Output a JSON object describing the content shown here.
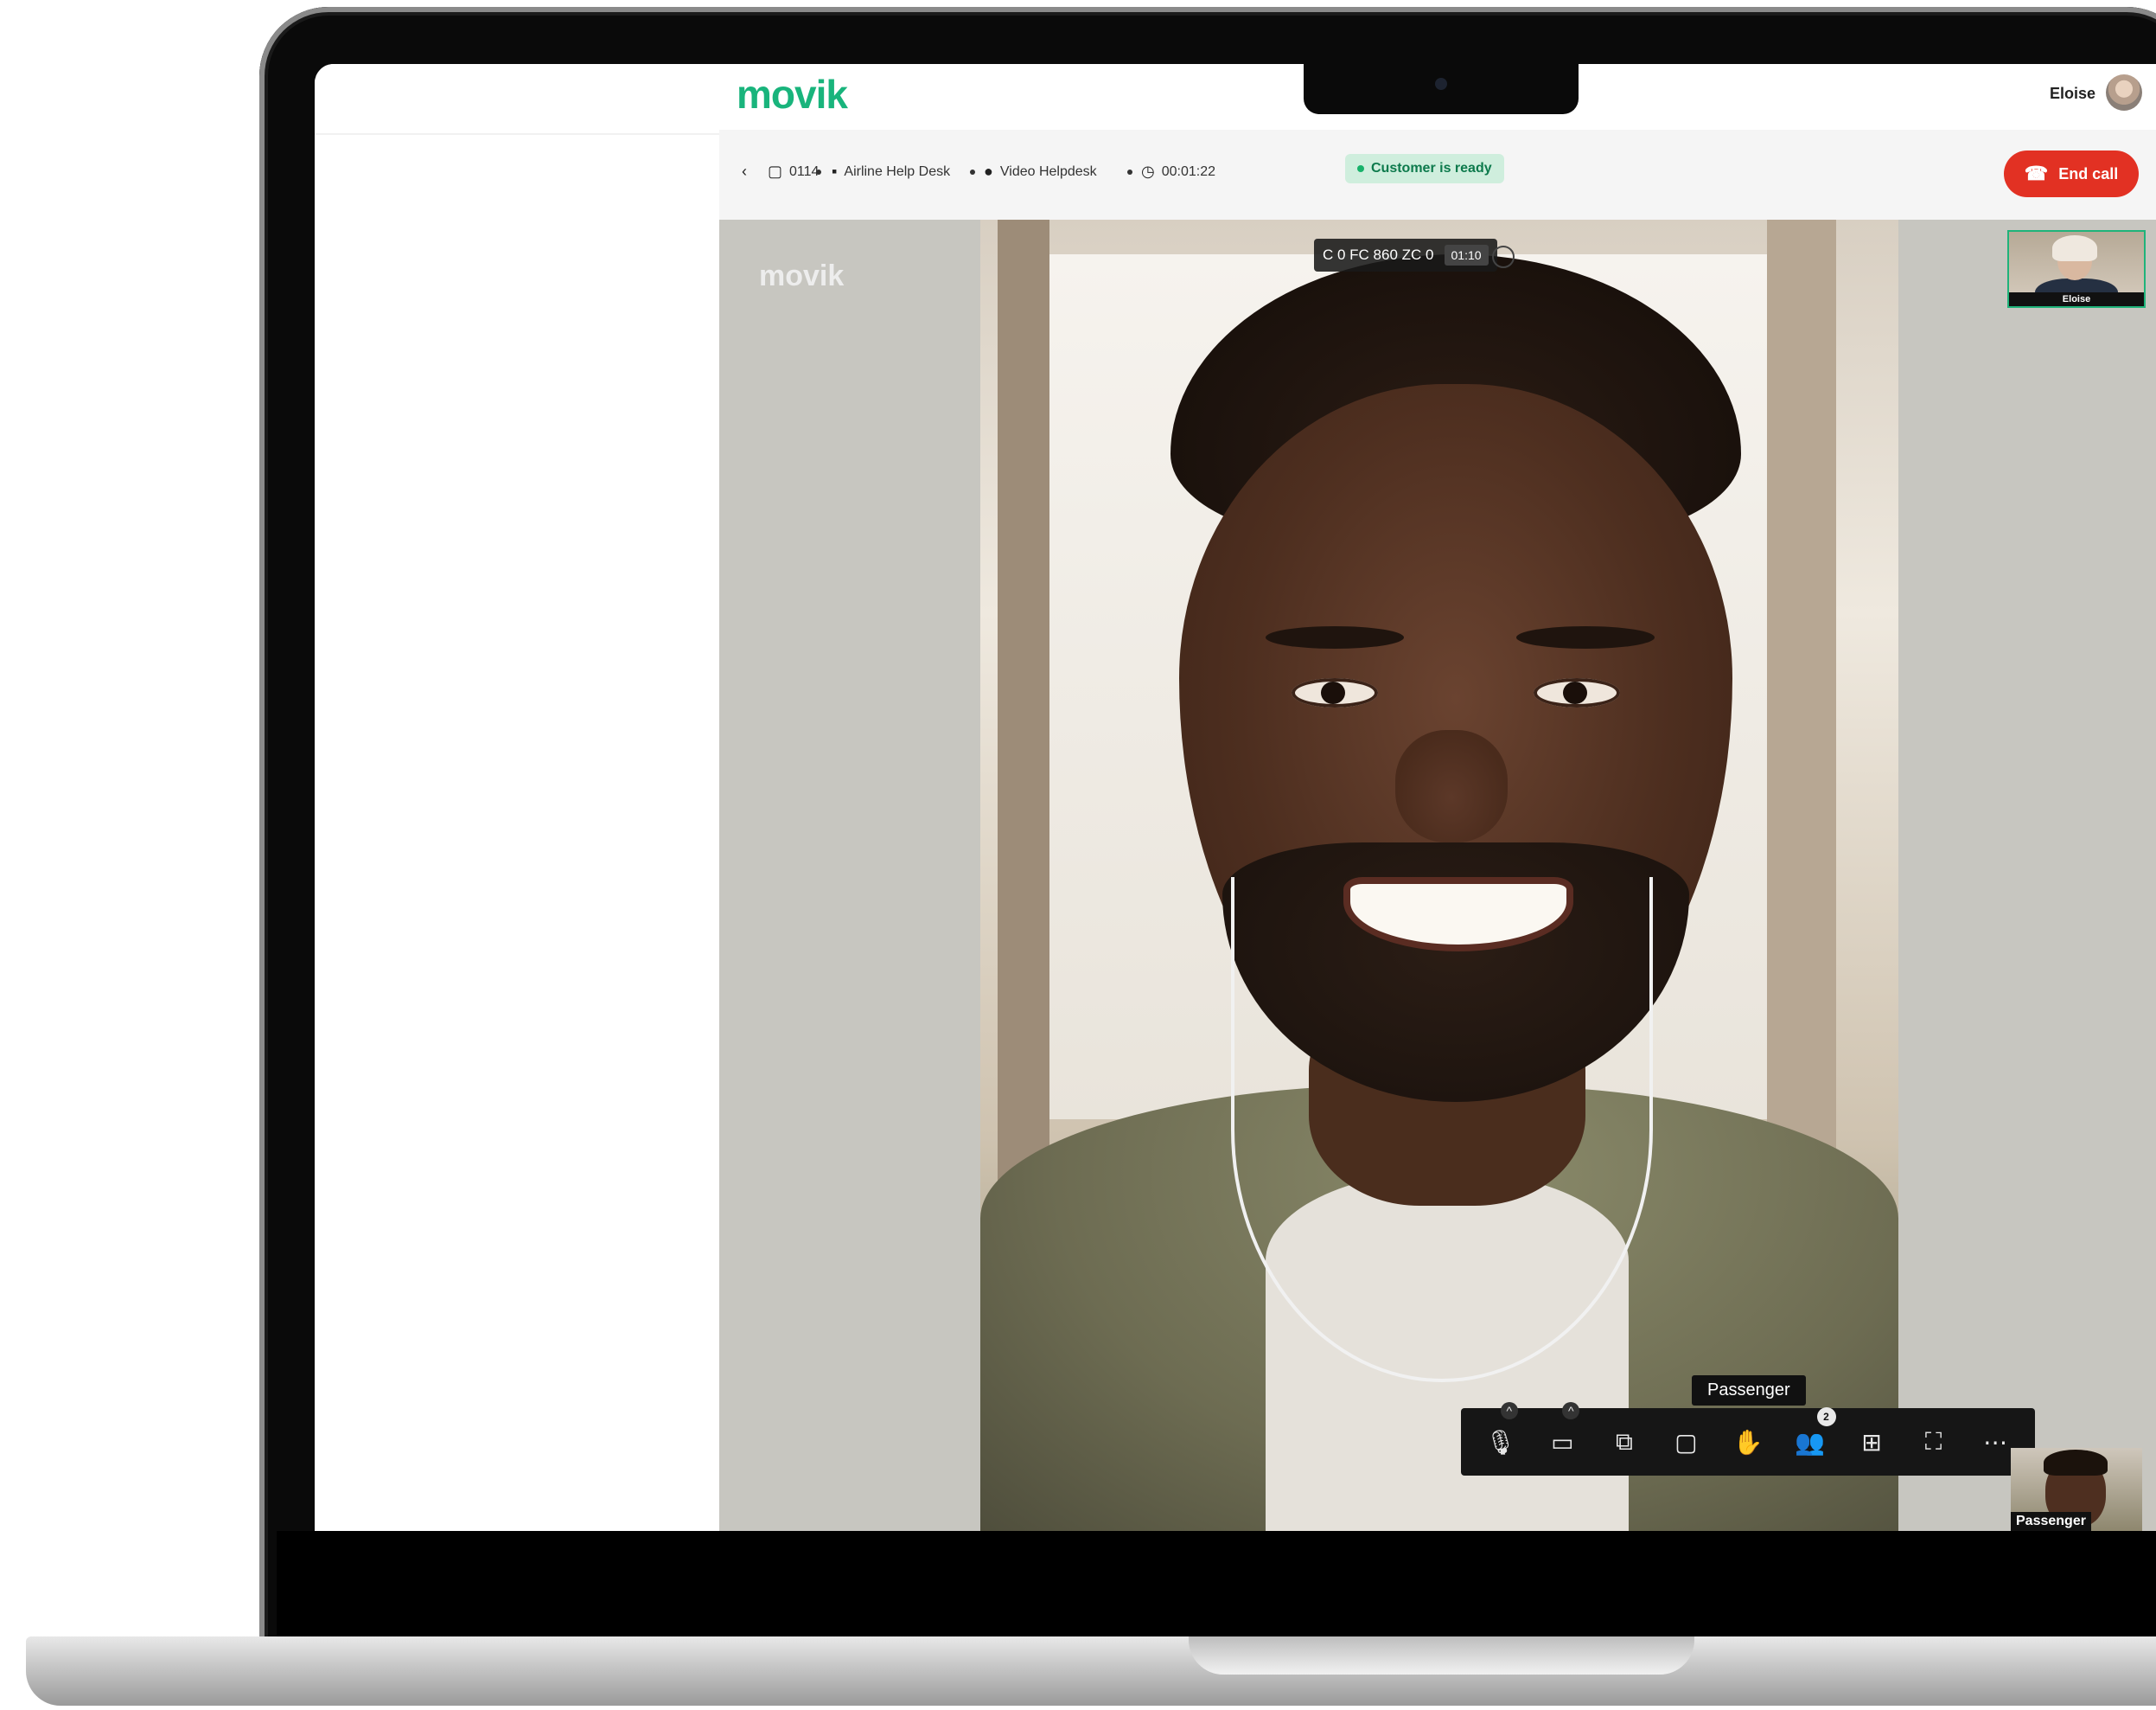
{
  "app": {
    "brand": "movik",
    "user_name": "Eloise"
  },
  "breadcrumb": {
    "case_id": "0114",
    "department": "Airline Help Desk",
    "channel": "Video Helpdesk",
    "elapsed": "00:01:22",
    "status": "Customer is ready",
    "end_call_label": "End call"
  },
  "stage": {
    "watermark": "movik",
    "recording_code": "C 0 FC 860 ZC 0",
    "recording_timer": "01:10",
    "main_participant_label": "Passenger",
    "participants_count": "2",
    "self_thumb_label": "Eloise",
    "remote_thumb_label": "Passenger"
  },
  "colors": {
    "brand_green": "#19b47c",
    "end_call_red": "#e23123",
    "status_bg": "#cfeedd",
    "status_text": "#0d7a4c"
  },
  "icons": {
    "back": "chevron-left-icon",
    "case": "ticket-icon",
    "department": "building-icon",
    "channel": "video-channel-icon",
    "timer": "clock-icon",
    "mic": "microphone-icon",
    "camera": "camera-icon",
    "share": "screen-share-icon",
    "chat": "chat-icon",
    "hand": "raise-hand-icon",
    "participants": "participants-icon",
    "grid": "grid-view-icon",
    "fullscreen": "fullscreen-icon",
    "more": "more-icon"
  }
}
